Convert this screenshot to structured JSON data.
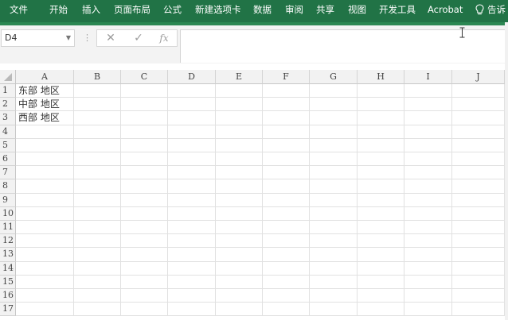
{
  "ribbon": {
    "tabs": [
      "文件",
      "开始",
      "插入",
      "页面布局",
      "公式",
      "新建选项卡",
      "数据",
      "审阅",
      "共享",
      "视图",
      "开发工具",
      "Acrobat"
    ],
    "tell_me": "告诉"
  },
  "formula_bar": {
    "name_box": "D4",
    "separator": "⋮",
    "cancel_icon": "✕",
    "enter_icon": "✓",
    "fx_label": "fx",
    "formula": ""
  },
  "sheet": {
    "columns": [
      "A",
      "B",
      "C",
      "D",
      "E",
      "F",
      "G",
      "H",
      "I",
      "J"
    ],
    "rows": [
      "1",
      "2",
      "3",
      "4",
      "5",
      "6",
      "7",
      "8",
      "9",
      "10",
      "11",
      "12",
      "13",
      "14",
      "15",
      "16",
      "17"
    ],
    "cells": {
      "A1": "东部  地区",
      "A2": "中部  地区",
      "A3": "西部  地区"
    },
    "active_cell": "D4"
  },
  "colors": {
    "ribbon": "#217346",
    "ribbon_text": "#ffffff",
    "header_bg": "#f2f2f2",
    "gridline": "#e1e1e1"
  }
}
